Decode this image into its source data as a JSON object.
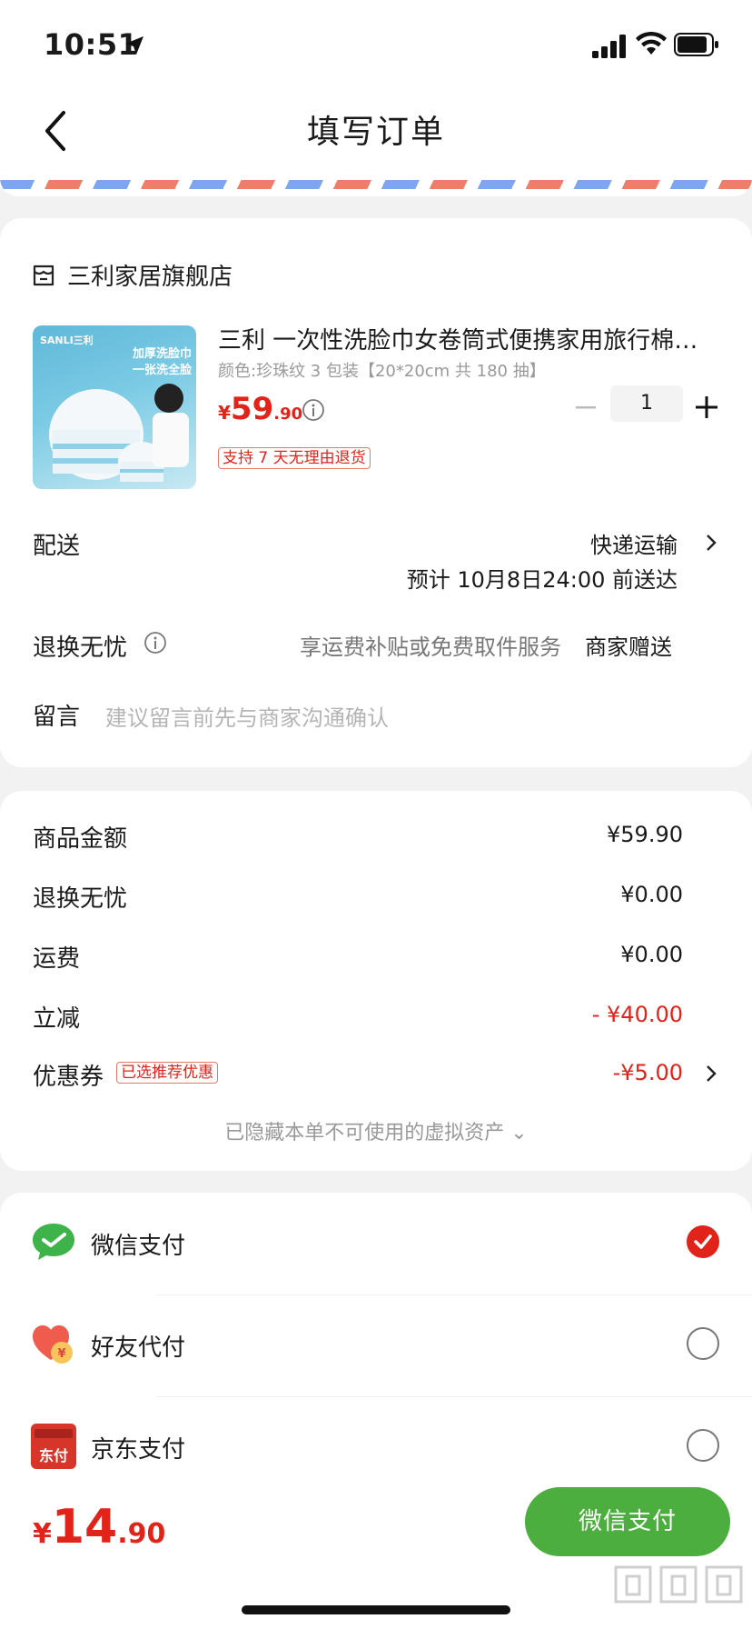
{
  "status_bar": {
    "time": "10:51"
  },
  "nav": {
    "title": "填写订单"
  },
  "store": {
    "name": "三利家居旗舰店"
  },
  "product": {
    "thumb_brand": "SANLI三利",
    "thumb_line1": "加厚洗脸巾",
    "thumb_line2": "一张洗全脸",
    "title": "三利 一次性洗脸巾女卷筒式便携家用旅行棉柔巾",
    "spec": "颜色:珍珠纹 3 包装【20*20cm 共 180 抽】",
    "price_symbol": "¥",
    "price_int": "59",
    "price_dec": ".90",
    "quantity": "1",
    "return_tag": "支持 7 天无理由退货"
  },
  "delivery": {
    "label": "配送",
    "method": "快递运输",
    "eta": "预计 10月8日24:00 前送达"
  },
  "worry_free": {
    "label": "退换无忧",
    "desc": "享运费补贴或免费取件服务",
    "value": "商家赠送"
  },
  "message": {
    "label": "留言",
    "placeholder": "建议留言前先与商家沟通确认"
  },
  "summary": {
    "rows": [
      {
        "label": "商品金额",
        "value": "¥59.90"
      },
      {
        "label": "退换无忧",
        "value": "¥0.00"
      },
      {
        "label": "运费",
        "value": "¥0.00"
      },
      {
        "label": "立减",
        "value": "- ¥40.00"
      },
      {
        "label": "优惠券",
        "value": "-¥5.00"
      }
    ],
    "coupon_tag": "已选推荐优惠",
    "hidden_assets": "已隐藏本单不可使用的虚拟资产 ⌄"
  },
  "payment": {
    "options": [
      {
        "label": "微信支付",
        "icon": "wechat-pay-icon",
        "selected": true
      },
      {
        "label": "好友代付",
        "icon": "friend-pay-icon",
        "selected": false
      },
      {
        "label": "京东支付",
        "icon": "jd-pay-icon",
        "selected": false
      }
    ],
    "jd_icon_text": "东付"
  },
  "bottom": {
    "total_symbol": "¥",
    "total_int": "14",
    "total_dec": ".90",
    "pay_button": "微信支付"
  },
  "colors": {
    "accent_red": "#e2231a",
    "wechat_green": "#4cae3e"
  }
}
